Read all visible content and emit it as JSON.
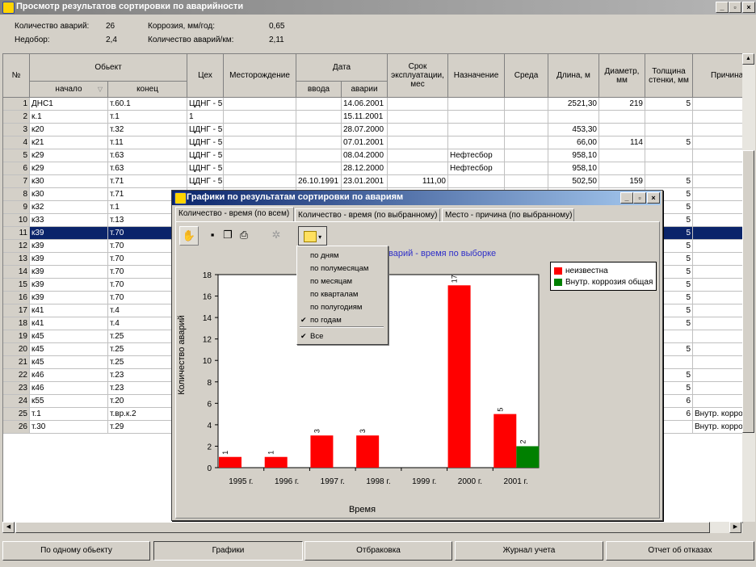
{
  "window": {
    "title": "Просмотр результатов сортировки по аварийности"
  },
  "summary": {
    "count_label": "Количество аварий:",
    "count_value": "26",
    "corrosion_label": "Коррозия, мм/год:",
    "corrosion_value": "0,65",
    "shortfall_label": "Недобор:",
    "shortfall_value": "2,4",
    "per_km_label": "Количество аварий/км:",
    "per_km_value": "2,11"
  },
  "grid": {
    "headers": {
      "no": "№",
      "object": "Обьект",
      "start": "начало",
      "end": "конец",
      "shop": "Цех",
      "field": "Месторождение",
      "date": "Дата",
      "date_in": "ввода",
      "date_fail": "аварии",
      "life": "Срок эксплуатации, мес",
      "purpose": "Назначение",
      "medium": "Среда",
      "length": "Длина, м",
      "diameter": "Диаметр, мм",
      "wall": "Толщина стенки, мм",
      "cause": "Причина"
    },
    "rows": [
      {
        "n": "1",
        "start": "ДНС1",
        "end": "т.60.1",
        "shop": "ЦДНГ - 5",
        "field": "",
        "date_in": "",
        "date_fail": "14.06.2001",
        "life": "",
        "purpose": "",
        "medium": "",
        "length": "2521,30",
        "diam": "219",
        "wall": "5",
        "cause": ""
      },
      {
        "n": "2",
        "start": "к.1",
        "end": "т.1",
        "shop": "1",
        "field": "",
        "date_in": "",
        "date_fail": "15.11.2001",
        "life": "",
        "purpose": "",
        "medium": "",
        "length": "",
        "diam": "",
        "wall": "",
        "cause": ""
      },
      {
        "n": "3",
        "start": "к20",
        "end": "т.32",
        "shop": "ЦДНГ - 5",
        "field": "",
        "date_in": "",
        "date_fail": "28.07.2000",
        "life": "",
        "purpose": "",
        "medium": "",
        "length": "453,30",
        "diam": "",
        "wall": "",
        "cause": ""
      },
      {
        "n": "4",
        "start": "к21",
        "end": "т.11",
        "shop": "ЦДНГ - 5",
        "field": "",
        "date_in": "",
        "date_fail": "07.01.2001",
        "life": "",
        "purpose": "",
        "medium": "",
        "length": "66,00",
        "diam": "114",
        "wall": "5",
        "cause": ""
      },
      {
        "n": "5",
        "start": "к29",
        "end": "т.63",
        "shop": "ЦДНГ - 5",
        "field": "",
        "date_in": "",
        "date_fail": "08.04.2000",
        "life": "",
        "purpose": "Нефтесбор",
        "medium": "",
        "length": "958,10",
        "diam": "",
        "wall": "",
        "cause": ""
      },
      {
        "n": "6",
        "start": "к29",
        "end": "т.63",
        "shop": "ЦДНГ - 5",
        "field": "",
        "date_in": "",
        "date_fail": "28.12.2000",
        "life": "",
        "purpose": "Нефтесбор",
        "medium": "",
        "length": "958,10",
        "diam": "",
        "wall": "",
        "cause": ""
      },
      {
        "n": "7",
        "start": "к30",
        "end": "т.71",
        "shop": "ЦДНГ - 5",
        "field": "",
        "date_in": "26.10.1991",
        "date_fail": "23.01.2001",
        "life": "111,00",
        "purpose": "",
        "medium": "",
        "length": "502,50",
        "diam": "159",
        "wall": "5",
        "cause": ""
      },
      {
        "n": "8",
        "start": "к30",
        "end": "т.71",
        "shop": "",
        "field": "",
        "date_in": "",
        "date_fail": "",
        "life": "",
        "purpose": "",
        "medium": "",
        "length": "",
        "diam": "",
        "wall": "5",
        "cause": ""
      },
      {
        "n": "9",
        "start": "к32",
        "end": "т.1",
        "shop": "",
        "field": "",
        "date_in": "",
        "date_fail": "",
        "life": "",
        "purpose": "",
        "medium": "",
        "length": "",
        "diam": "",
        "wall": "5",
        "cause": ""
      },
      {
        "n": "10",
        "start": "к33",
        "end": "т.13",
        "shop": "",
        "field": "",
        "date_in": "",
        "date_fail": "",
        "life": "",
        "purpose": "",
        "medium": "",
        "length": "",
        "diam": "",
        "wall": "5",
        "cause": ""
      },
      {
        "n": "11",
        "start": "к39",
        "end": "т.70",
        "shop": "",
        "field": "",
        "date_in": "",
        "date_fail": "",
        "life": "",
        "purpose": "",
        "medium": "",
        "length": "",
        "diam": "",
        "wall": "5",
        "cause": "",
        "selected": true
      },
      {
        "n": "12",
        "start": "к39",
        "end": "т.70",
        "shop": "",
        "field": "",
        "date_in": "",
        "date_fail": "",
        "life": "",
        "purpose": "",
        "medium": "",
        "length": "",
        "diam": "",
        "wall": "5",
        "cause": ""
      },
      {
        "n": "13",
        "start": "к39",
        "end": "т.70",
        "shop": "",
        "field": "",
        "date_in": "",
        "date_fail": "",
        "life": "",
        "purpose": "",
        "medium": "",
        "length": "",
        "diam": "",
        "wall": "5",
        "cause": ""
      },
      {
        "n": "14",
        "start": "к39",
        "end": "т.70",
        "shop": "",
        "field": "",
        "date_in": "",
        "date_fail": "",
        "life": "",
        "purpose": "",
        "medium": "",
        "length": "",
        "diam": "",
        "wall": "5",
        "cause": ""
      },
      {
        "n": "15",
        "start": "к39",
        "end": "т.70",
        "shop": "",
        "field": "",
        "date_in": "",
        "date_fail": "",
        "life": "",
        "purpose": "",
        "medium": "",
        "length": "",
        "diam": "",
        "wall": "5",
        "cause": ""
      },
      {
        "n": "16",
        "start": "к39",
        "end": "т.70",
        "shop": "",
        "field": "",
        "date_in": "",
        "date_fail": "",
        "life": "",
        "purpose": "",
        "medium": "",
        "length": "",
        "diam": "",
        "wall": "5",
        "cause": ""
      },
      {
        "n": "17",
        "start": "к41",
        "end": "т.4",
        "shop": "",
        "field": "",
        "date_in": "",
        "date_fail": "",
        "life": "",
        "purpose": "",
        "medium": "",
        "length": "",
        "diam": "",
        "wall": "5",
        "cause": ""
      },
      {
        "n": "18",
        "start": "к41",
        "end": "т.4",
        "shop": "",
        "field": "",
        "date_in": "",
        "date_fail": "",
        "life": "",
        "purpose": "",
        "medium": "",
        "length": "",
        "diam": "",
        "wall": "5",
        "cause": ""
      },
      {
        "n": "19",
        "start": "к45",
        "end": "т.25",
        "shop": "",
        "field": "",
        "date_in": "",
        "date_fail": "",
        "life": "",
        "purpose": "",
        "medium": "",
        "length": "",
        "diam": "",
        "wall": "",
        "cause": ""
      },
      {
        "n": "20",
        "start": "к45",
        "end": "т.25",
        "shop": "",
        "field": "",
        "date_in": "",
        "date_fail": "",
        "life": "",
        "purpose": "",
        "medium": "",
        "length": "",
        "diam": "",
        "wall": "5",
        "cause": ""
      },
      {
        "n": "21",
        "start": "к45",
        "end": "т.25",
        "shop": "",
        "field": "",
        "date_in": "",
        "date_fail": "",
        "life": "",
        "purpose": "",
        "medium": "",
        "length": "",
        "diam": "",
        "wall": "",
        "cause": ""
      },
      {
        "n": "22",
        "start": "к46",
        "end": "т.23",
        "shop": "",
        "field": "",
        "date_in": "",
        "date_fail": "",
        "life": "",
        "purpose": "",
        "medium": "",
        "length": "",
        "diam": "",
        "wall": "5",
        "cause": ""
      },
      {
        "n": "23",
        "start": "к46",
        "end": "т.23",
        "shop": "",
        "field": "",
        "date_in": "",
        "date_fail": "",
        "life": "",
        "purpose": "",
        "medium": "",
        "length": "",
        "diam": "",
        "wall": "5",
        "cause": ""
      },
      {
        "n": "24",
        "start": "к55",
        "end": "т.20",
        "shop": "",
        "field": "",
        "date_in": "",
        "date_fail": "",
        "life": "",
        "purpose": "",
        "medium": "",
        "length": "",
        "diam": "",
        "wall": "6",
        "cause": ""
      },
      {
        "n": "25",
        "start": "т.1",
        "end": "т.вр.к.2",
        "shop": "",
        "field": "",
        "date_in": "",
        "date_fail": "",
        "life": "",
        "purpose": "",
        "medium": "",
        "length": "",
        "diam": "",
        "wall": "6",
        "cause": "Внутр. корроз"
      },
      {
        "n": "26",
        "start": "т.30",
        "end": "т.29",
        "shop": "",
        "field": "",
        "date_in": "",
        "date_fail": "",
        "life": "",
        "purpose": "",
        "medium": "",
        "length": "",
        "diam": "",
        "wall": "",
        "cause": "Внутр. корроз"
      }
    ]
  },
  "buttons": {
    "by_object": "По одному обьекту",
    "charts": "Графики",
    "reject": "Отбраковка",
    "log": "Журнал учета",
    "report": "Отчет об отказах"
  },
  "dialog": {
    "title": "Графики по результатам сортировки по авариям",
    "tabs": [
      "Количество - время (по всем)",
      "Количество - время (по выбранному)",
      "Место - причина (по выбранному)"
    ],
    "chart_title_visible": "варий - время по выборке",
    "menu": {
      "items": [
        "по дням",
        "по полумесяцам",
        "по месяцам",
        "по кварталам",
        "по полугодиям",
        "по годам"
      ],
      "checked": "по годам",
      "all": "Все"
    }
  },
  "colors": {
    "red": "#ff0000",
    "green": "#008000",
    "selection": "#0a246a",
    "chart_title": "#2e2ec8"
  },
  "chart_data": {
    "type": "bar",
    "title": "",
    "xlabel": "Время",
    "ylabel": "Количество аварий",
    "categories": [
      "1995 г.",
      "1996 г.",
      "1997 г.",
      "1998 г.",
      "1999 г.",
      "2000 г.",
      "2001 г."
    ],
    "series": [
      {
        "name": "неизвестна",
        "color": "#ff0000",
        "values": [
          1,
          1,
          3,
          3,
          0,
          17,
          5
        ]
      },
      {
        "name": "Внутр. коррозия общая",
        "color": "#008000",
        "values": [
          0,
          0,
          0,
          0,
          0,
          0,
          2
        ]
      }
    ],
    "yticks": [
      "0",
      "2",
      "4",
      "6",
      "8",
      "10",
      "12",
      "14",
      "16",
      "18"
    ],
    "ylim": [
      0,
      18
    ],
    "grid": false,
    "legend": "top-right"
  }
}
